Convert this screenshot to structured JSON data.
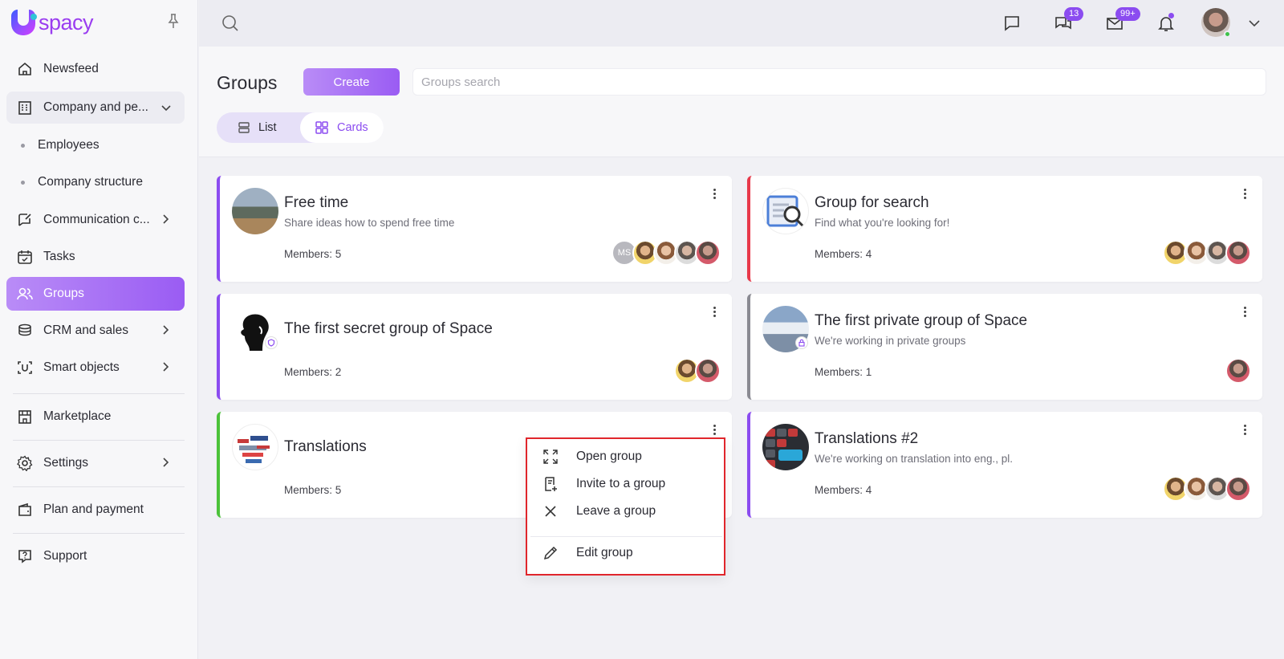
{
  "app": {
    "logo_text": "spacy",
    "brand_color": "#8b4cf0"
  },
  "sidebar": {
    "items": [
      {
        "label": "Newsfeed",
        "icon": "home-icon"
      },
      {
        "label": "Company and pe...",
        "icon": "building-icon"
      },
      {
        "label": "Employees"
      },
      {
        "label": "Company structure"
      },
      {
        "label": "Communication c...",
        "icon": "communication-icon"
      },
      {
        "label": "Tasks",
        "icon": "calendar-check-icon"
      },
      {
        "label": "Groups",
        "icon": "users-icon"
      },
      {
        "label": "CRM and sales",
        "icon": "coins-icon"
      },
      {
        "label": "Smart objects",
        "icon": "smart-objects-icon"
      },
      {
        "label": "Marketplace",
        "icon": "store-icon"
      },
      {
        "label": "Settings",
        "icon": "gear-icon"
      },
      {
        "label": "Plan and payment",
        "icon": "wallet-icon"
      },
      {
        "label": "Support",
        "icon": "help-icon"
      }
    ]
  },
  "topbar": {
    "chat_badge": "13",
    "mail_badge": "99+"
  },
  "header": {
    "title": "Groups",
    "create_label": "Create",
    "search_placeholder": "Groups search",
    "view_list": "List",
    "view_cards": "Cards"
  },
  "groups": [
    {
      "name": "Free time",
      "description": "Share ideas how to spend free time",
      "members": "Members: 5",
      "accent": "#8b4cf0"
    },
    {
      "name": "Group for search",
      "description": "Find what you're looking for!",
      "members": "Members: 4",
      "accent": "#e8394a"
    },
    {
      "name": "The first secret group of Space",
      "description": "",
      "members": "Members: 2",
      "accent": "#8b4cf0"
    },
    {
      "name": "The first private group of Space",
      "description": "We're working in private groups",
      "members": "Members: 1",
      "accent": "#8a8a92"
    },
    {
      "name": "Translations",
      "description": "",
      "members": "Members: 5",
      "accent": "#4cc23a"
    },
    {
      "name": "Translations #2",
      "description": "We're working on translation into eng., pl.",
      "members": "Members: 4",
      "accent": "#8b4cf0"
    }
  ],
  "avatar_initials": "MS",
  "context_menu": {
    "items": [
      {
        "label": "Open group",
        "icon": "expand-icon"
      },
      {
        "label": "Invite to a group",
        "icon": "invite-icon"
      },
      {
        "label": "Leave a group",
        "icon": "close-icon"
      },
      {
        "label": "Edit group",
        "icon": "pencil-icon"
      }
    ]
  }
}
